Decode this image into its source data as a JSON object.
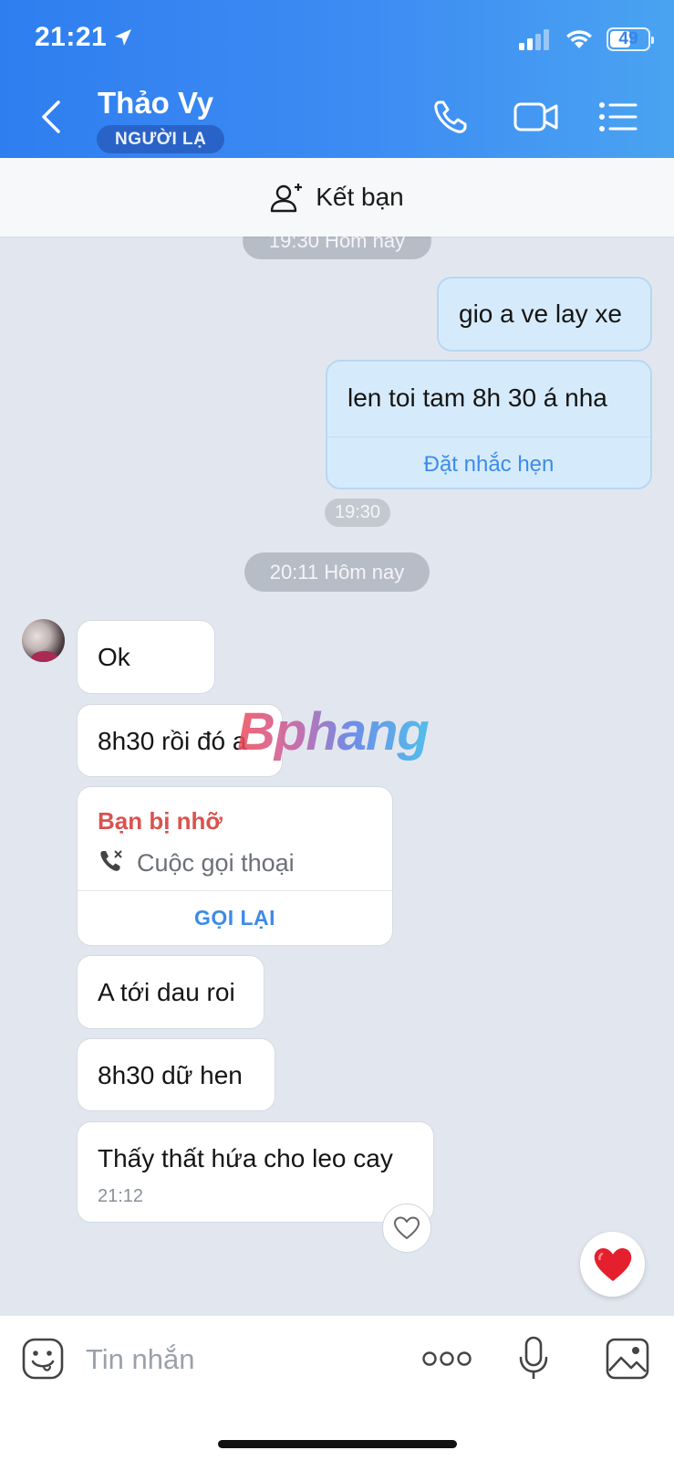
{
  "status": {
    "time": "21:21",
    "battery": "49"
  },
  "header": {
    "title": "Thảo Vy",
    "badge": "NGƯỜI LẠ"
  },
  "add_friend": {
    "label": "Kết bạn"
  },
  "messages": {
    "top_pill": "19:30 Hôm nay",
    "out1": "gio a ve lay xe",
    "out2": "len toi tam 8h 30 á nha",
    "reminder_action": "Đặt nhắc hẹn",
    "out_time": "19:30",
    "day_pill": "20:11 Hôm nay",
    "in1": "Ok",
    "in2": "8h30 rồi đó a",
    "missed_title": "Bạn bị nhỡ",
    "missed_subtitle": "Cuộc gọi thoại",
    "callback_action": "GỌI LẠI",
    "in3": "A tới dau roi",
    "in4": "8h30 dữ hen",
    "in5": "Thấy thất hứa cho leo cay",
    "in5_time": "21:12"
  },
  "watermark": "Bphang",
  "composer": {
    "placeholder": "Tin nhắn"
  },
  "colors": {
    "header_start": "#2f7ef0",
    "header_end": "#4aa3f1",
    "chat_bg": "#e2e7ef",
    "outgoing_bubble": "#d5ebfb",
    "accent_blue": "#3d8be8",
    "missed_red": "#d9534f",
    "heart_red": "#e5202e"
  }
}
